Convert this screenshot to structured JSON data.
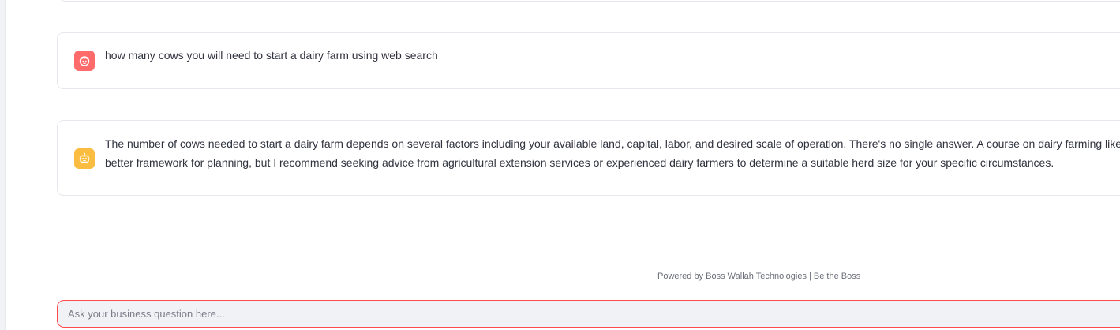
{
  "chat": {
    "messages": [
      {
        "role": "user",
        "avatar_icon": "user-face-icon",
        "text": "how many cows you will need to start a dairy farm using web search"
      },
      {
        "role": "assistant",
        "avatar_icon": "robot-icon",
        "line1": "The number of cows needed to start a dairy farm depends on several factors including your available land, capital, labor, and desired scale of operation. There's no single answer. A course on dairy farming like the",
        "line2": "better framework for planning, but I recommend seeking advice from agricultural extension services or experienced dairy farmers to determine a suitable herd size for your specific circumstances."
      }
    ],
    "footer": "Powered by Boss Wallah Technologies | Be the Boss",
    "input": {
      "placeholder": "Ask your business question here...",
      "value": ""
    }
  },
  "colors": {
    "user_avatar": "#ff6b6b",
    "assistant_avatar": "#fbbd41",
    "input_focus_border": "#ff4b4b"
  }
}
